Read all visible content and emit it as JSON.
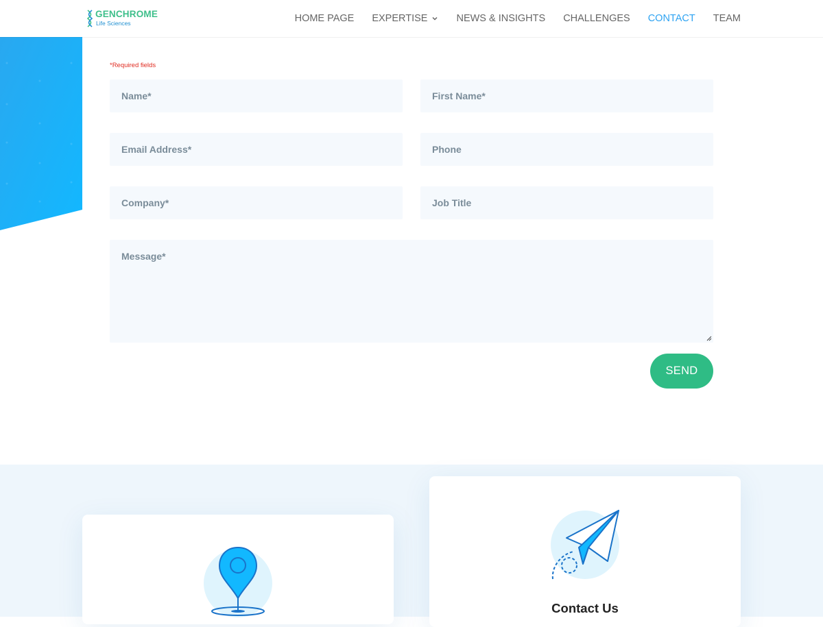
{
  "brand": {
    "name": "GENCHROME",
    "sub": "Life Sciences"
  },
  "nav": {
    "items": [
      {
        "label": "HOME PAGE",
        "active": false
      },
      {
        "label": "EXPERTISE",
        "active": false,
        "has_dropdown": true
      },
      {
        "label": "NEWS & INSIGHTS",
        "active": false
      },
      {
        "label": "CHALLENGES",
        "active": false
      },
      {
        "label": "CONTACT",
        "active": true
      },
      {
        "label": "TEAM",
        "active": false
      }
    ]
  },
  "form": {
    "required_note": "*Required fields",
    "fields": {
      "name": "Name*",
      "first_name": "First Name*",
      "email": "Email Address*",
      "phone": "Phone",
      "company": "Company*",
      "job_title": "Job Title",
      "message": "Message*"
    },
    "send_label": "SEND"
  },
  "cards": {
    "location": {
      "icon": "location-pin-icon"
    },
    "contact": {
      "icon": "paper-plane-icon",
      "title": "Contact Us"
    }
  },
  "colors": {
    "accent": "#2ea3f2",
    "send_button": "#2fbc85",
    "brand_green": "#3dbf8a",
    "field_bg": "#f5f9fd",
    "required": "#e02b20",
    "section_bg": "#eef6fc"
  }
}
